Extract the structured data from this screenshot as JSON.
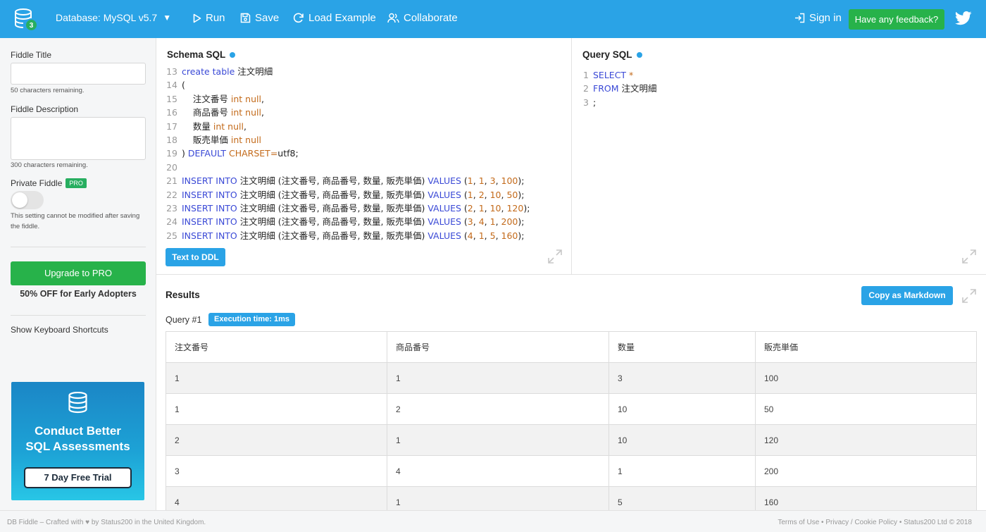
{
  "topbar": {
    "db_badge": "3",
    "database_label": "Database: MySQL v5.7",
    "run_label": "Run",
    "save_label": "Save",
    "load_example_label": "Load Example",
    "collaborate_label": "Collaborate",
    "sign_in_label": "Sign in",
    "feedback_label": "Have any feedback?"
  },
  "sidebar": {
    "title_label": "Fiddle Title",
    "title_value": "",
    "title_hint": "50 characters remaining.",
    "description_label": "Fiddle Description",
    "description_value": "",
    "description_hint": "300 characters remaining.",
    "private_label": "Private Fiddle",
    "pro_badge": "PRO",
    "private_enabled": false,
    "private_hint": "This setting cannot be modified after saving the fiddle.",
    "upgrade_label": "Upgrade to PRO",
    "offer_text": "50% OFF for Early Adopters",
    "shortcuts_label": "Show Keyboard Shortcuts",
    "ad": {
      "line1": "Conduct Better",
      "line2": "SQL Assessments",
      "button": "7 Day Free Trial"
    }
  },
  "schema": {
    "title": "Schema SQL",
    "text_to_ddl_label": "Text to DDL",
    "lines": [
      {
        "n": "13",
        "tokens": [
          [
            "kw",
            "create table"
          ],
          [
            "txt",
            " 注文明細"
          ]
        ]
      },
      {
        "n": "14",
        "tokens": [
          [
            "txt",
            "("
          ]
        ]
      },
      {
        "n": "15",
        "tokens": [
          [
            "txt",
            "    注文番号 "
          ],
          [
            "ty",
            "int null"
          ],
          [
            "txt",
            ","
          ]
        ]
      },
      {
        "n": "16",
        "tokens": [
          [
            "txt",
            "    商品番号 "
          ],
          [
            "ty",
            "int null"
          ],
          [
            "txt",
            ","
          ]
        ]
      },
      {
        "n": "17",
        "tokens": [
          [
            "txt",
            "    数量 "
          ],
          [
            "ty",
            "int null"
          ],
          [
            "txt",
            ","
          ]
        ]
      },
      {
        "n": "18",
        "tokens": [
          [
            "txt",
            "    販売単価 "
          ],
          [
            "ty",
            "int null"
          ]
        ]
      },
      {
        "n": "19",
        "tokens": [
          [
            "txt",
            ") "
          ],
          [
            "kw",
            "DEFAULT"
          ],
          [
            "ty",
            " CHARSET="
          ],
          [
            "txt",
            "utf8;"
          ]
        ]
      },
      {
        "n": "20",
        "tokens": []
      },
      {
        "n": "21",
        "tokens": [
          [
            "kw",
            "INSERT INTO"
          ],
          [
            "txt",
            " 注文明細 (注文番号, 商品番号, 数量, 販売単価) "
          ],
          [
            "kw",
            "VALUES"
          ],
          [
            "txt",
            " ("
          ],
          [
            "num",
            "1"
          ],
          [
            "txt",
            ", "
          ],
          [
            "num",
            "1"
          ],
          [
            "txt",
            ", "
          ],
          [
            "num",
            "3"
          ],
          [
            "txt",
            ", "
          ],
          [
            "num",
            "100"
          ],
          [
            "txt",
            ");"
          ]
        ]
      },
      {
        "n": "22",
        "tokens": [
          [
            "kw",
            "INSERT INTO"
          ],
          [
            "txt",
            " 注文明細 (注文番号, 商品番号, 数量, 販売単価) "
          ],
          [
            "kw",
            "VALUES"
          ],
          [
            "txt",
            " ("
          ],
          [
            "num",
            "1"
          ],
          [
            "txt",
            ", "
          ],
          [
            "num",
            "2"
          ],
          [
            "txt",
            ", "
          ],
          [
            "num",
            "10"
          ],
          [
            "txt",
            ", "
          ],
          [
            "num",
            "50"
          ],
          [
            "txt",
            ");"
          ]
        ]
      },
      {
        "n": "23",
        "tokens": [
          [
            "kw",
            "INSERT INTO"
          ],
          [
            "txt",
            " 注文明細 (注文番号, 商品番号, 数量, 販売単価) "
          ],
          [
            "kw",
            "VALUES"
          ],
          [
            "txt",
            " ("
          ],
          [
            "num",
            "2"
          ],
          [
            "txt",
            ", "
          ],
          [
            "num",
            "1"
          ],
          [
            "txt",
            ", "
          ],
          [
            "num",
            "10"
          ],
          [
            "txt",
            ", "
          ],
          [
            "num",
            "120"
          ],
          [
            "txt",
            ");"
          ]
        ]
      },
      {
        "n": "24",
        "tokens": [
          [
            "kw",
            "INSERT INTO"
          ],
          [
            "txt",
            " 注文明細 (注文番号, 商品番号, 数量, 販売単価) "
          ],
          [
            "kw",
            "VALUES"
          ],
          [
            "txt",
            " ("
          ],
          [
            "num",
            "3"
          ],
          [
            "txt",
            ", "
          ],
          [
            "num",
            "4"
          ],
          [
            "txt",
            ", "
          ],
          [
            "num",
            "1"
          ],
          [
            "txt",
            ", "
          ],
          [
            "num",
            "200"
          ],
          [
            "txt",
            ");"
          ]
        ]
      },
      {
        "n": "25",
        "tokens": [
          [
            "kw",
            "INSERT INTO"
          ],
          [
            "txt",
            " 注文明細 (注文番号, 商品番号, 数量, 販売単価) "
          ],
          [
            "kw",
            "VALUES"
          ],
          [
            "txt",
            " ("
          ],
          [
            "num",
            "4"
          ],
          [
            "txt",
            ", "
          ],
          [
            "num",
            "1"
          ],
          [
            "txt",
            ", "
          ],
          [
            "num",
            "5"
          ],
          [
            "txt",
            ", "
          ],
          [
            "num",
            "160"
          ],
          [
            "txt",
            ");"
          ]
        ]
      }
    ]
  },
  "query": {
    "title": "Query SQL",
    "lines": [
      {
        "n": "1",
        "tokens": [
          [
            "kw",
            "SELECT"
          ],
          [
            "num",
            " *"
          ]
        ]
      },
      {
        "n": "2",
        "tokens": [
          [
            "kw",
            "FROM"
          ],
          [
            "txt",
            " 注文明細"
          ]
        ]
      },
      {
        "n": "3",
        "tokens": [
          [
            "txt",
            ";"
          ]
        ]
      }
    ]
  },
  "results": {
    "title": "Results",
    "copy_markdown_label": "Copy as Markdown",
    "query_label": "Query #1",
    "execution_time": "Execution time: 1ms",
    "columns": [
      "注文番号",
      "商品番号",
      "数量",
      "販売単価"
    ],
    "rows": [
      [
        "1",
        "1",
        "3",
        "100"
      ],
      [
        "1",
        "2",
        "10",
        "50"
      ],
      [
        "2",
        "1",
        "10",
        "120"
      ],
      [
        "3",
        "4",
        "1",
        "200"
      ],
      [
        "4",
        "1",
        "5",
        "160"
      ]
    ]
  },
  "footer": {
    "left": "DB Fiddle – Crafted with ♥ by Status200 in the United Kingdom.",
    "terms": "Terms of Use",
    "privacy": "Privacy / Cookie Policy",
    "copyright": "Status200 Ltd © 2018"
  }
}
